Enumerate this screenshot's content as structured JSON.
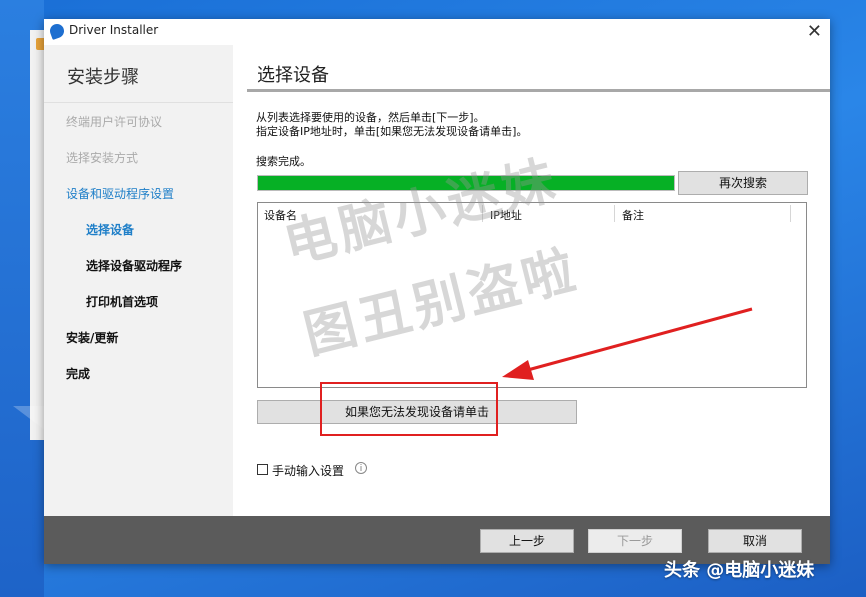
{
  "window": {
    "title": "Driver Installer"
  },
  "sidebar": {
    "title": "安装步骤",
    "steps": [
      {
        "label": "终端用户许可协议",
        "state": "done"
      },
      {
        "label": "选择安装方式",
        "state": "done"
      },
      {
        "label": "设备和驱动程序设置",
        "state": "current"
      },
      {
        "label": "选择设备",
        "state": "active-sub"
      },
      {
        "label": "选择设备驱动程序",
        "state": "pending"
      },
      {
        "label": "打印机首选项",
        "state": "pending"
      },
      {
        "label": "安装/更新",
        "state": "pending"
      },
      {
        "label": "完成",
        "state": "pending"
      }
    ]
  },
  "main": {
    "section_title": "选择设备",
    "instructions": [
      "从列表选择要使用的设备，然后单击[下一步]。",
      "指定设备IP地址时，单击[如果您无法发现设备请单击]。"
    ],
    "status": "搜索完成。",
    "progress": 1.0,
    "search_again_label": "再次搜索",
    "columns": [
      "设备名",
      "IP地址",
      "备注"
    ],
    "not_found_button_label": "如果您无法发现设备请单击",
    "manual_input_label": "手动输入设置",
    "manual_input_checked": false
  },
  "footer": {
    "back_label": "上一步",
    "next_label": "下一步",
    "cancel_label": "取消"
  },
  "watermark": {
    "line1": "电脑小迷妹",
    "line2": "图丑别盗啦"
  },
  "source_tag": "头条 @电脑小迷妹",
  "colors": {
    "progress": "#06b025",
    "sidebar_current": "#1f7fc8",
    "annotation": "#e02020",
    "footer_bg": "#5b5b5b"
  }
}
